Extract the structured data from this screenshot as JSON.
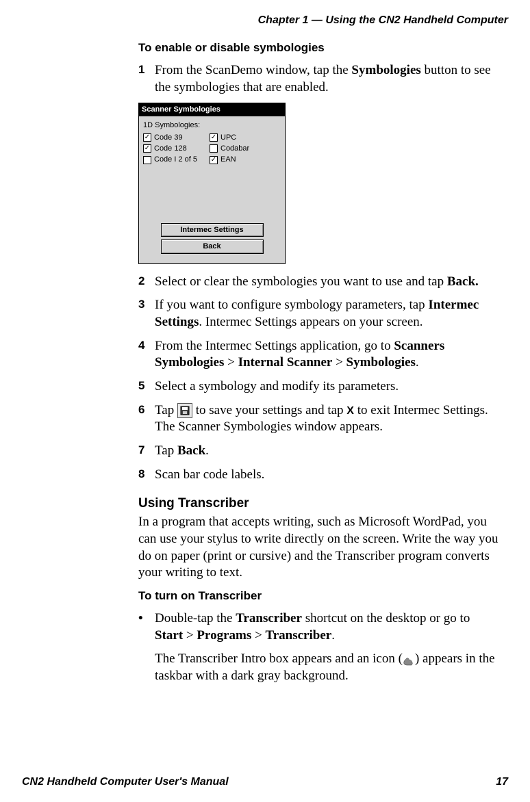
{
  "running_head": "Chapter 1 — Using the CN2 Handheld Computer",
  "heading1": "To enable or disable symbologies",
  "steps": {
    "s1_a": "From the ScanDemo window, tap the ",
    "s1_b": "Symbologies",
    "s1_c": " button to see the symbologies that are enabled.",
    "s2_a": "Select or clear the symbologies you want to use and tap ",
    "s2_b": "Back.",
    "s3_a": "If you want to configure symbology parameters, tap ",
    "s3_b": "Intermec Settings",
    "s3_c": ". Intermec Settings appears on your screen.",
    "s4_a": "From the Intermec Settings application, go to ",
    "s4_b": "Scanners Symbologies",
    "s4_c": " > ",
    "s4_d": "Internal Scanner",
    "s4_e": " > ",
    "s4_f": "Symbologies",
    "s4_g": ".",
    "s5": "Select a symbology and modify its parameters.",
    "s6_a": "Tap ",
    "s6_b": " to save your settings and tap  ",
    "s6_x": "X",
    "s6_c": "  to exit Intermec Settings. The Scanner Symbologies window appears.",
    "s7_a": "Tap ",
    "s7_b": "Back",
    "s7_c": ".",
    "s8": "Scan bar code labels."
  },
  "section2": {
    "title": "Using Transcriber",
    "para": "In a program that accepts writing, such as Microsoft WordPad, you can use your stylus to write directly on the screen. Write the way you do on paper (print or cursive) and the Transcriber program converts your writing to text."
  },
  "heading2": "To turn on Transcriber",
  "bullet": {
    "a": "Double-tap the ",
    "b": "Transcriber",
    "c": " shortcut on the desktop or go to ",
    "d": "Start",
    "e": " > ",
    "f": "Programs",
    "g": " > ",
    "h": "Transcriber",
    "i": ".",
    "follow": "The Transcriber Intro box appears and an icon (",
    "follow2": ") appears in the taskbar with a dark gray background."
  },
  "screenshot": {
    "title": "Scanner Symbologies",
    "section_label": "1D Symbologies:",
    "left": [
      {
        "label": "Code 39",
        "checked": true
      },
      {
        "label": "Code 128",
        "checked": true
      },
      {
        "label": "Code I 2 of 5",
        "checked": false
      }
    ],
    "right": [
      {
        "label": "UPC",
        "checked": true
      },
      {
        "label": "Codabar",
        "checked": false
      },
      {
        "label": "EAN",
        "checked": true
      }
    ],
    "btn1": "Intermec Settings",
    "btn2": "Back"
  },
  "footer": {
    "left": "CN2 Handheld Computer User's Manual",
    "right": "17"
  }
}
